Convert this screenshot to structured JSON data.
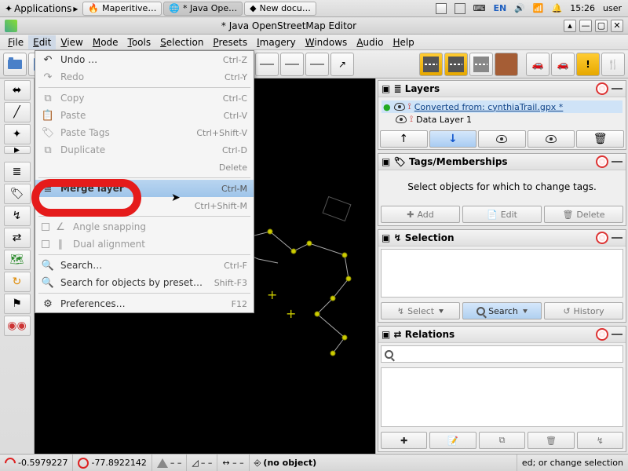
{
  "sysbar": {
    "appmenu": "Applications",
    "tasks": [
      "Maperitive…",
      "* Java Ope…",
      "New docu…"
    ],
    "lang": "EN",
    "clock": "15:26",
    "user": "user"
  },
  "window": {
    "title": "* Java OpenStreetMap Editor"
  },
  "menus": [
    "File",
    "Edit",
    "View",
    "Mode",
    "Tools",
    "Selection",
    "Presets",
    "Imagery",
    "Windows",
    "Audio",
    "Help"
  ],
  "editmenu": [
    {
      "icon": "↶",
      "label": "Undo …",
      "shortcut": "Ctrl-Z",
      "dis": false
    },
    {
      "icon": "↷",
      "label": "Redo",
      "shortcut": "Ctrl-Y",
      "dis": true
    },
    {
      "sep": true
    },
    {
      "icon": "⧉",
      "label": "Copy",
      "shortcut": "Ctrl-C",
      "dis": true
    },
    {
      "icon": "📋",
      "label": "Paste",
      "shortcut": "Ctrl-V",
      "dis": true
    },
    {
      "icon": "🏷",
      "label": "Paste Tags",
      "shortcut": "Ctrl+Shift-V",
      "dis": true
    },
    {
      "icon": "⧉",
      "label": "Duplicate",
      "shortcut": "Ctrl-D",
      "dis": true
    },
    {
      "icon": "",
      "label": "",
      "shortcut": "Delete",
      "dis": true
    },
    {
      "sep": true
    },
    {
      "icon": "≣",
      "label": "Merge layer",
      "shortcut": "Ctrl-M",
      "dis": false,
      "hl": true
    },
    {
      "icon": "",
      "label": "",
      "shortcut": "Ctrl+Shift-M",
      "dis": true
    },
    {
      "sep": true
    },
    {
      "chk": true,
      "icon": "∠",
      "label": "Angle snapping",
      "shortcut": "",
      "dis": true
    },
    {
      "chk": true,
      "icon": "∥",
      "label": "Dual alignment",
      "shortcut": "",
      "dis": true
    },
    {
      "sep": true
    },
    {
      "icon": "🔍",
      "label": "Search…",
      "shortcut": "Ctrl-F",
      "dis": false
    },
    {
      "icon": "🔍",
      "label": "Search for objects by preset…",
      "shortcut": "Shift-F3",
      "dis": false
    },
    {
      "sep": true
    },
    {
      "icon": "⚙",
      "label": "Preferences…",
      "shortcut": "F12",
      "dis": false
    }
  ],
  "panels": {
    "layers": {
      "title": "Layers",
      "rows": [
        {
          "name": "Converted from: cynthiaTrail.gpx *",
          "sel": true,
          "chk": true
        },
        {
          "name": "Data Layer 1",
          "sel": false,
          "chk": false
        }
      ]
    },
    "tags": {
      "title": "Tags/Memberships",
      "hint": "Select objects for which to change tags.",
      "add": "Add",
      "edit": "Edit",
      "del": "Delete"
    },
    "selection": {
      "title": "Selection",
      "select": "Select",
      "search": "Search",
      "history": "History"
    },
    "relations": {
      "title": "Relations"
    }
  },
  "status": {
    "lat": "-0.5979227",
    "lon": "-77.8922142",
    "obj": "(no object)",
    "hint": "ed; or change selection"
  }
}
